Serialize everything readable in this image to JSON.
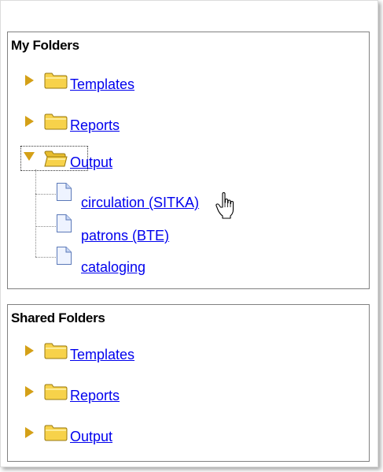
{
  "my_folders": {
    "title": "My Folders",
    "folders": [
      {
        "label": "Templates",
        "expanded": false
      },
      {
        "label": "Reports",
        "expanded": false
      },
      {
        "label": "Output",
        "expanded": true
      }
    ],
    "output_children": [
      {
        "label": "circulation (SITKA)"
      },
      {
        "label": "patrons (BTE)"
      },
      {
        "label": "cataloging"
      }
    ]
  },
  "shared_folders": {
    "title": "Shared Folders",
    "folders": [
      {
        "label": "Templates",
        "expanded": false
      },
      {
        "label": "Reports",
        "expanded": false
      },
      {
        "label": "Output",
        "expanded": false
      }
    ]
  },
  "colors": {
    "link": "#0000ee",
    "arrow": "#d4a017",
    "folder_fill": "#f7d24a",
    "folder_stroke": "#9a7a10",
    "panel_border": "#808080"
  },
  "icons": {
    "collapsed": "triangle-right-icon",
    "expanded": "triangle-down-icon",
    "folder": "folder-icon",
    "document": "document-icon",
    "cursor": "hand-pointer-cursor"
  }
}
